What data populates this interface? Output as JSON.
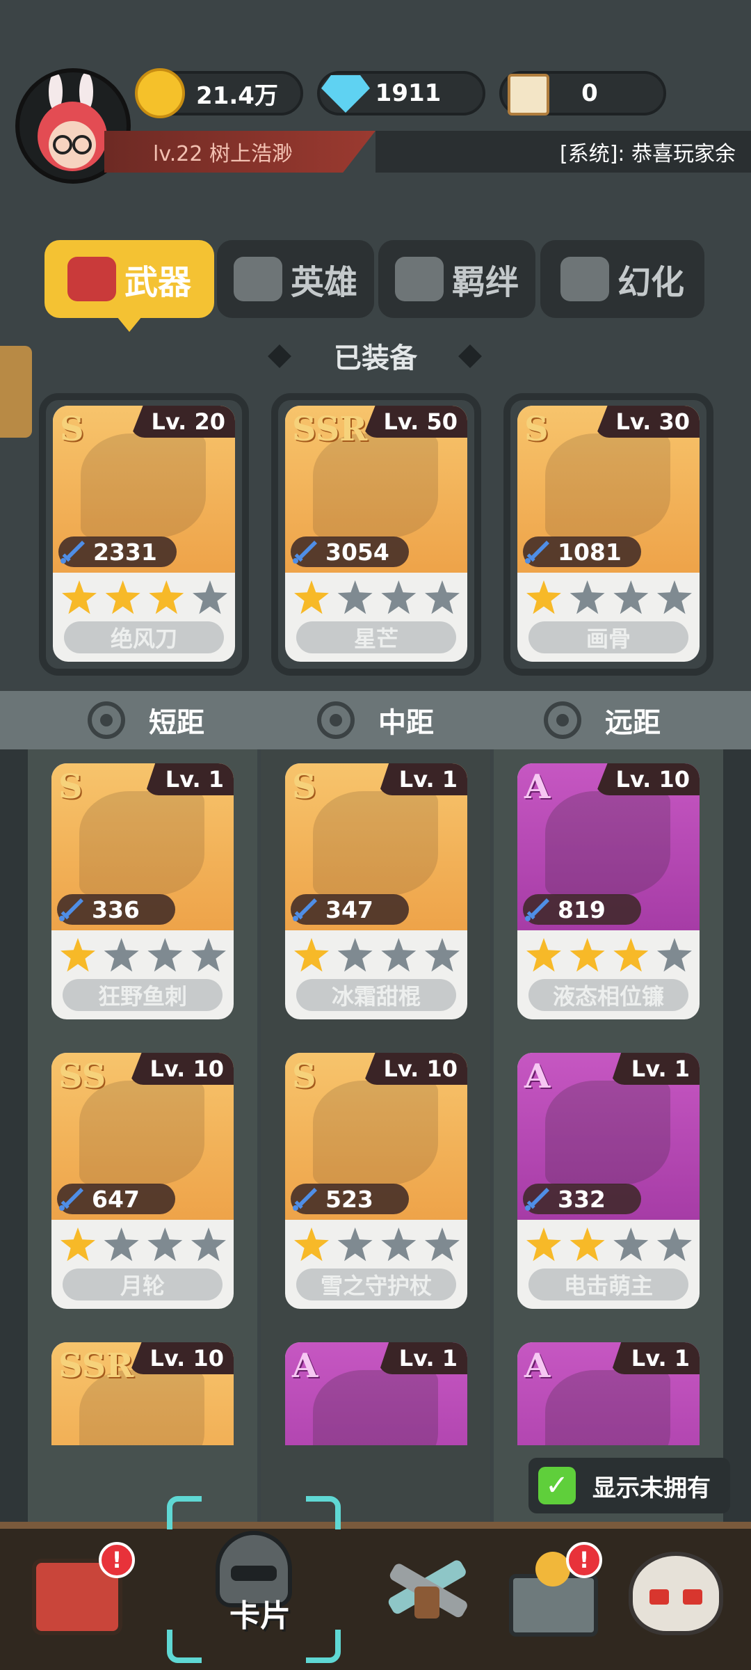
{
  "header": {
    "gold": "21.4万",
    "diamonds": "1911",
    "scrolls": "0",
    "level_name": "lv.22  树上浩渺",
    "system_message": "[系统]: 恭喜玩家余"
  },
  "tabs": [
    {
      "label": "武器",
      "active": true
    },
    {
      "label": "英雄",
      "active": false
    },
    {
      "label": "羁绊",
      "active": false
    },
    {
      "label": "幻化",
      "active": false
    }
  ],
  "equipped_label": "已装备",
  "equipped": [
    {
      "rarity": "S",
      "level": "Lv. 20",
      "power": "2331",
      "stars": 3,
      "name": "绝风刀",
      "bg": "gold",
      "icon": "twin-blades-icon"
    },
    {
      "rarity": "SSR",
      "level": "Lv. 50",
      "power": "3054",
      "stars": 1,
      "name": "星芒",
      "bg": "gold",
      "icon": "umbrella-icon"
    },
    {
      "rarity": "S",
      "level": "Lv. 30",
      "power": "1081",
      "stars": 1,
      "name": "画骨",
      "bg": "gold",
      "icon": "whip-icon"
    }
  ],
  "ranges": [
    "短距",
    "中距",
    "远距"
  ],
  "weapons": [
    {
      "rarity": "S",
      "level": "Lv. 1",
      "power": "336",
      "stars": 1,
      "name": "狂野鱼刺",
      "bg": "gold",
      "icon": "fishbone-icon"
    },
    {
      "rarity": "S",
      "level": "Lv. 1",
      "power": "347",
      "stars": 1,
      "name": "冰霜甜棍",
      "bg": "gold",
      "icon": "popsicle-icon"
    },
    {
      "rarity": "A",
      "level": "Lv. 10",
      "power": "819",
      "stars": 3,
      "name": "液态相位镰",
      "bg": "pink",
      "icon": "scythe-icon"
    },
    {
      "rarity": "SS",
      "level": "Lv. 10",
      "power": "647",
      "stars": 1,
      "name": "月轮",
      "bg": "gold",
      "icon": "moon-blade-icon"
    },
    {
      "rarity": "S",
      "level": "Lv. 10",
      "power": "523",
      "stars": 1,
      "name": "雪之守护杖",
      "bg": "gold",
      "icon": "heart-staff-icon"
    },
    {
      "rarity": "A",
      "level": "Lv. 1",
      "power": "332",
      "stars": 2,
      "name": "电击萌主",
      "bg": "pink",
      "icon": "plug-icon"
    },
    {
      "rarity": "SSR",
      "level": "Lv. 10",
      "bg": "gold",
      "icon": "pig-icon"
    },
    {
      "rarity": "A",
      "level": "Lv. 1",
      "bg": "pink",
      "icon": "axe-icon"
    },
    {
      "rarity": "A",
      "level": "Lv. 1",
      "bg": "pink",
      "icon": "bone-sword-icon"
    }
  ],
  "show_unowned": {
    "label": "显示未拥有",
    "checked": true
  },
  "nav": [
    {
      "name": "shop",
      "icon": "shop-icon",
      "badge": "!"
    },
    {
      "name": "cards",
      "icon": "knight-helmet-icon",
      "label": "卡片",
      "active": true
    },
    {
      "name": "battle",
      "icon": "crossed-guns-icon"
    },
    {
      "name": "treasure",
      "icon": "treasure-chest-icon",
      "badge": "!"
    },
    {
      "name": "boss",
      "icon": "skull-icon"
    }
  ],
  "colors": {
    "accent": "#f4c233",
    "gold_card": "#eea349",
    "pink_card": "#a63ca6",
    "badge": "#e8323a",
    "check": "#5fcf3b"
  }
}
